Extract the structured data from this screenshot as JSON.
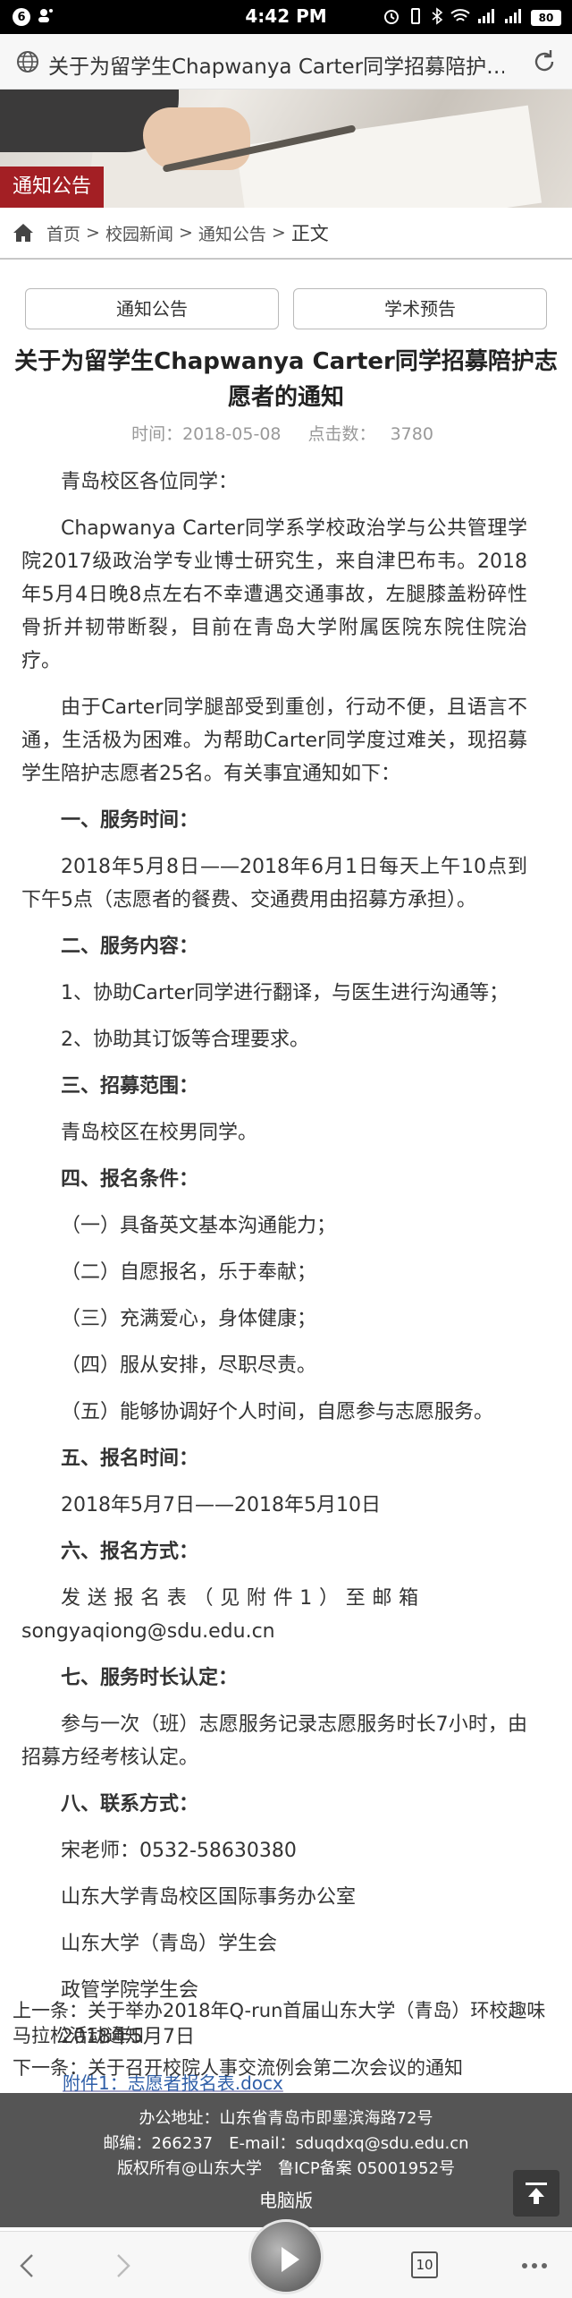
{
  "status_bar": {
    "badge_left": "6",
    "time": "4:42 PM",
    "battery": "80"
  },
  "url_bar": {
    "title": "关于为留学生Chapwanya Carter同学招募陪护…"
  },
  "banner": {
    "label": "通知公告"
  },
  "breadcrumb": {
    "home": "首页",
    "sep": ">",
    "items": [
      "校园新闻",
      "通知公告"
    ],
    "current": "正文"
  },
  "tabs": [
    "通知公告",
    "学术预告"
  ],
  "article": {
    "title": "关于为留学生Chapwanya Carter同学招募陪护志愿者的通知",
    "time_label": "时间：2018-05-08",
    "clicks_label": "点击数：",
    "clicks_value": "3780",
    "greeting": "青岛校区各位同学：",
    "para1": "Chapwanya Carter同学系学校政治学与公共管理学院2017级政治学专业博士研究生，来自津巴布韦。2018年5月4日晚8点左右不幸遭遇交通事故，左腿膝盖粉碎性骨折并韧带断裂，目前在青岛大学附属医院东院住院治疗。",
    "para2": "由于Carter同学腿部受到重创，行动不便，且语言不通，生活极为困难。为帮助Carter同学度过难关，现招募学生陪护志愿者25名。有关事宜通知如下：",
    "h1": "一、服务时间：",
    "s1": "2018年5月8日——2018年6月1日每天上午10点到下午5点（志愿者的餐费、交通费用由招募方承担）。",
    "h2": "二、服务内容：",
    "s2a": "1、协助Carter同学进行翻译，与医生进行沟通等；",
    "s2b": "2、协助其订饭等合理要求。",
    "h3": "三、招募范围：",
    "s3": "青岛校区在校男同学。",
    "h4": "四、报名条件：",
    "s4a": "（一）具备英文基本沟通能力；",
    "s4b": "（二）自愿报名，乐于奉献；",
    "s4c": "（三）充满爱心，身体健康；",
    "s4d": "（四）服从安排，尽职尽责。",
    "s4e": "（五）能够协调好个人时间，自愿参与志愿服务。",
    "h5": "五、报名时间：",
    "s5": "2018年5月7日——2018年5月10日",
    "h6": "六、报名方式：",
    "s6a": "发送报名表（见附件1）至邮箱",
    "s6b": "songyaqiong@sdu.edu.cn",
    "h7": "七、服务时长认定：",
    "s7": "参与一次（班）志愿服务记录志愿服务时长7小时，由招募方经考核认定。",
    "h8": "八、联系方式：",
    "c1": "宋老师：0532-58630380",
    "c2": "山东大学青岛校区国际事务办公室",
    "c3": "山东大学（青岛）学生会",
    "c4": "政管学院学生会",
    "date": "2018年5月7日",
    "attachment": "附件1：志愿者报名表.docx"
  },
  "prev": "上一条：关于举办2018年Q-run首届山东大学（青岛）环校趣味马拉松活动通知",
  "next": "下一条：关于召开校院人事交流例会第二次会议的通知",
  "footer": {
    "address": "办公地址：山东省青岛市即墨滨海路72号",
    "contact": "邮编：266237　E-mail：sduqdxq@sdu.edu.cn",
    "copyright": "版权所有@山东大学　鲁ICP备案 05001952号",
    "pc_version": "电脑版"
  },
  "bottom_nav": {
    "tab_count": "10"
  }
}
